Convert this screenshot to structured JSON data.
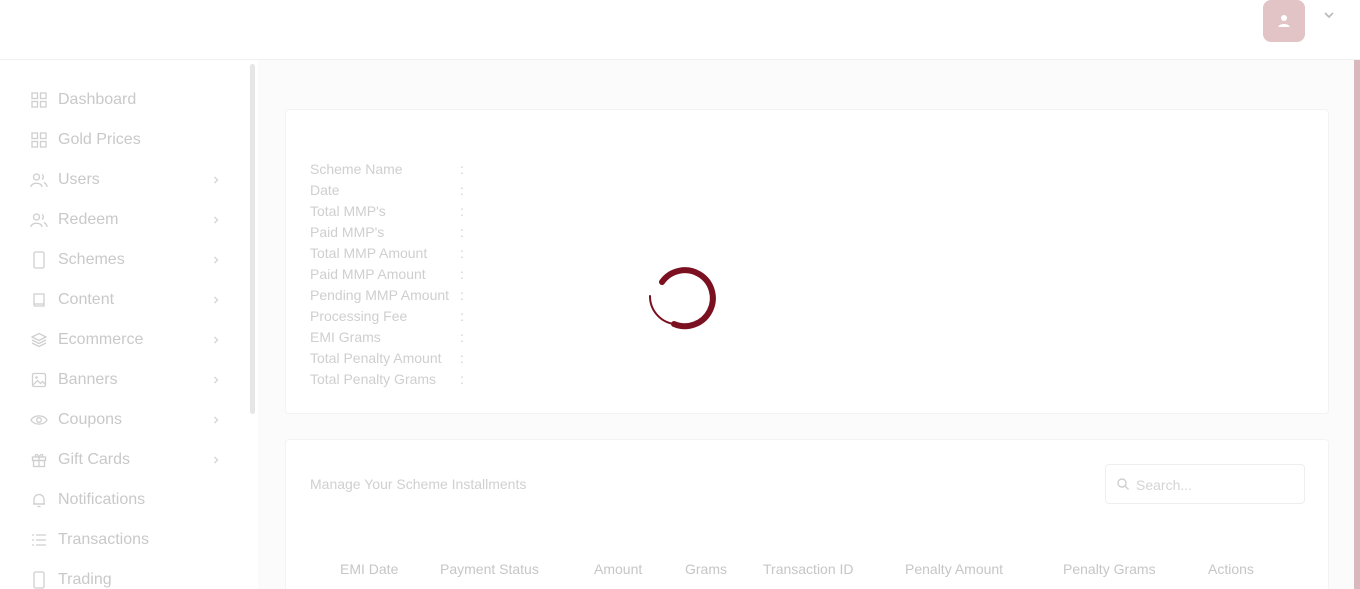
{
  "header": {
    "avatar_icon": "user-icon",
    "menu_icon": "chevron-down-icon"
  },
  "sidebar": {
    "items": [
      {
        "label": "Dashboard",
        "icon": "grid-icon",
        "has_submenu": false
      },
      {
        "label": "Gold Prices",
        "icon": "grid-icon",
        "has_submenu": false
      },
      {
        "label": "Users",
        "icon": "users-icon",
        "has_submenu": true
      },
      {
        "label": "Redeem",
        "icon": "users-icon",
        "has_submenu": true
      },
      {
        "label": "Schemes",
        "icon": "tablet-icon",
        "has_submenu": true
      },
      {
        "label": "Content",
        "icon": "book-icon",
        "has_submenu": true
      },
      {
        "label": "Ecommerce",
        "icon": "layers-icon",
        "has_submenu": true
      },
      {
        "label": "Banners",
        "icon": "image-icon",
        "has_submenu": true
      },
      {
        "label": "Coupons",
        "icon": "eye-icon",
        "has_submenu": true
      },
      {
        "label": "Gift Cards",
        "icon": "gift-icon",
        "has_submenu": true
      },
      {
        "label": "Notifications",
        "icon": "bell-icon",
        "has_submenu": false
      },
      {
        "label": "Transactions",
        "icon": "list-icon",
        "has_submenu": false
      },
      {
        "label": "Trading",
        "icon": "tablet-icon",
        "has_submenu": false
      }
    ]
  },
  "details": {
    "rows": [
      {
        "label": "Scheme Name",
        "sep": ":"
      },
      {
        "label": "Date",
        "sep": ":"
      },
      {
        "label": "Total MMP's",
        "sep": ":"
      },
      {
        "label": "Paid MMP's",
        "sep": ":"
      },
      {
        "label": "Total MMP Amount",
        "sep": ":"
      },
      {
        "label": "Paid MMP Amount",
        "sep": ":"
      },
      {
        "label": "Pending MMP Amount",
        "sep": ":"
      },
      {
        "label": "Processing Fee",
        "sep": ":"
      },
      {
        "label": "EMI Grams",
        "sep": ":"
      },
      {
        "label": "Total Penalty Amount",
        "sep": ":"
      },
      {
        "label": "Total Penalty Grams",
        "sep": ":"
      }
    ]
  },
  "installments": {
    "title": "Manage Your Scheme Installments",
    "search_placeholder": "Search...",
    "columns": [
      "EMI Date",
      "Payment Status",
      "Amount",
      "Grams",
      "Transaction ID",
      "Penalty Amount",
      "Penalty Grams",
      "Actions"
    ]
  },
  "colors": {
    "accent": "#7a1020",
    "avatar_bg": "#e2c3c6",
    "muted_text": "#c9c9c9"
  }
}
